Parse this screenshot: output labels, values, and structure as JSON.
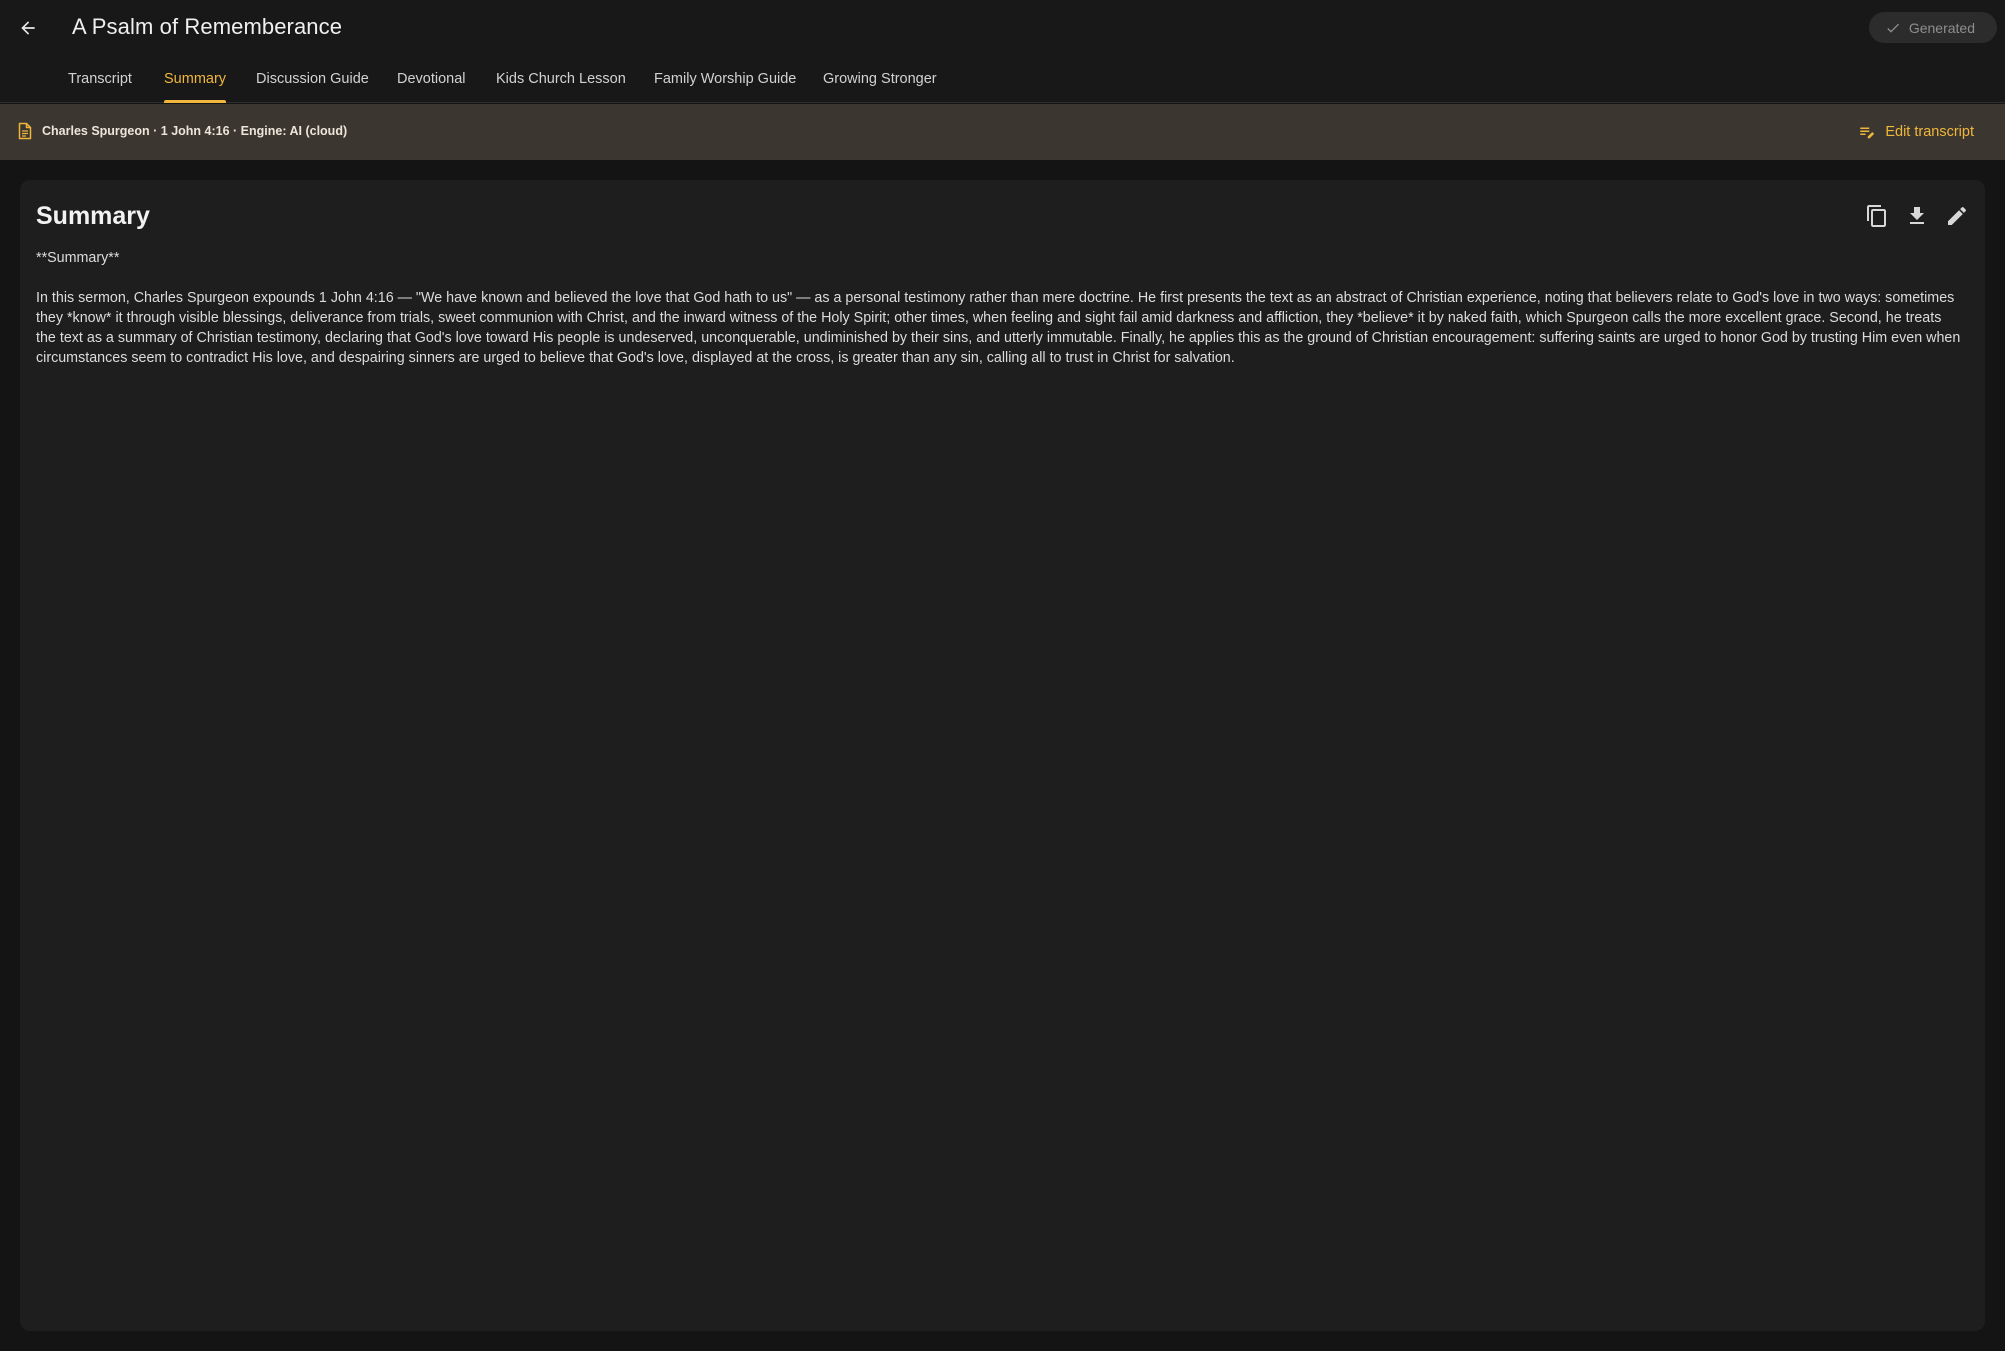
{
  "header": {
    "title": "A Psalm of Rememberance",
    "back_icon": "arrow-left-icon",
    "status_label": "Generated",
    "status_icon": "check-icon"
  },
  "tabs": [
    {
      "label": "Transcript",
      "active": false
    },
    {
      "label": "Summary",
      "active": true
    },
    {
      "label": "Discussion Guide",
      "active": false
    },
    {
      "label": "Devotional",
      "active": false
    },
    {
      "label": "Kids Church Lesson",
      "active": false
    },
    {
      "label": "Family Worship Guide",
      "active": false
    },
    {
      "label": "Growing Stronger",
      "active": false
    }
  ],
  "info_bar": {
    "icon": "document-icon",
    "text": "Charles Spurgeon · 1 John 4:16 · Engine: AI (cloud)",
    "edit_label": "Edit transcript",
    "edit_icon": "edit-list-icon"
  },
  "card": {
    "title": "Summary",
    "actions": [
      "copy-icon",
      "download-icon",
      "pencil-icon"
    ],
    "heading_line": "**Summary**",
    "body": "In this sermon, Charles Spurgeon expounds 1 John 4:16 — \"We have known and believed the love that God hath to us\" — as a personal testimony rather than mere doctrine. He first presents the text as an abstract of Christian experience, noting that believers relate to God's love in two ways: sometimes they *know* it through visible blessings, deliverance from trials, sweet communion with Christ, and the inward witness of the Holy Spirit; other times, when feeling and sight fail amid darkness and affliction, they *believe* it by naked faith, which Spurgeon calls the more excellent grace. Second, he treats the text as a summary of Christian testimony, declaring that God's love toward His people is undeserved, unconquerable, undiminished by their sins, and utterly immutable. Finally, he applies this as the ground of Christian encouragement: suffering saints are urged to honor God by trusting Him even when circumstances seem to contradict His love, and despairing sinners are urged to believe that God's love, displayed at the cross, is greater than any sin, calling all to trust in Christ for salvation."
  },
  "colors": {
    "accent": "#f0b63c",
    "background": "#141414",
    "card": "#1e1e1e",
    "info_bar": "#3b3730"
  }
}
